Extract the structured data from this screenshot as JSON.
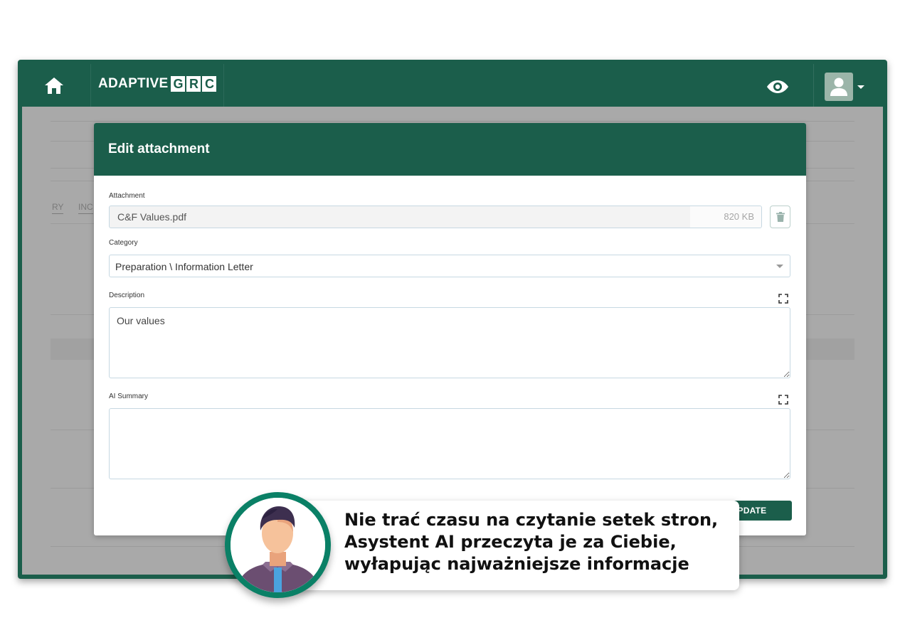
{
  "header": {
    "logo_prefix": "ADAPTIVE",
    "logo_letters": [
      "G",
      "R",
      "C"
    ],
    "home_icon": "home-icon",
    "view_icon": "eye-icon",
    "user_icon": "user-icon"
  },
  "background": {
    "tabs": [
      "RY",
      "INC"
    ]
  },
  "modal": {
    "title": "Edit attachment",
    "attachment_label": "Attachment",
    "file_name": "C&F Values.pdf",
    "file_size": "820 KB",
    "category_label": "Category",
    "category_value": "Preparation \\ Information Letter",
    "description_label": "Description",
    "description_value": "Our values",
    "ai_summary_label": "AI Summary",
    "ai_summary_value": "",
    "update_label": "UPDATE"
  },
  "callout": {
    "lines": [
      "Nie trać czasu na czytanie setek stron,",
      "Asystent AI przeczyta je za Ciebie,",
      "wyłapując najważniejsze informacje"
    ]
  },
  "colors": {
    "brand_green": "#1b5e4b",
    "ring_green": "#0a8066",
    "overlay_gray": "#a9a9a9"
  }
}
